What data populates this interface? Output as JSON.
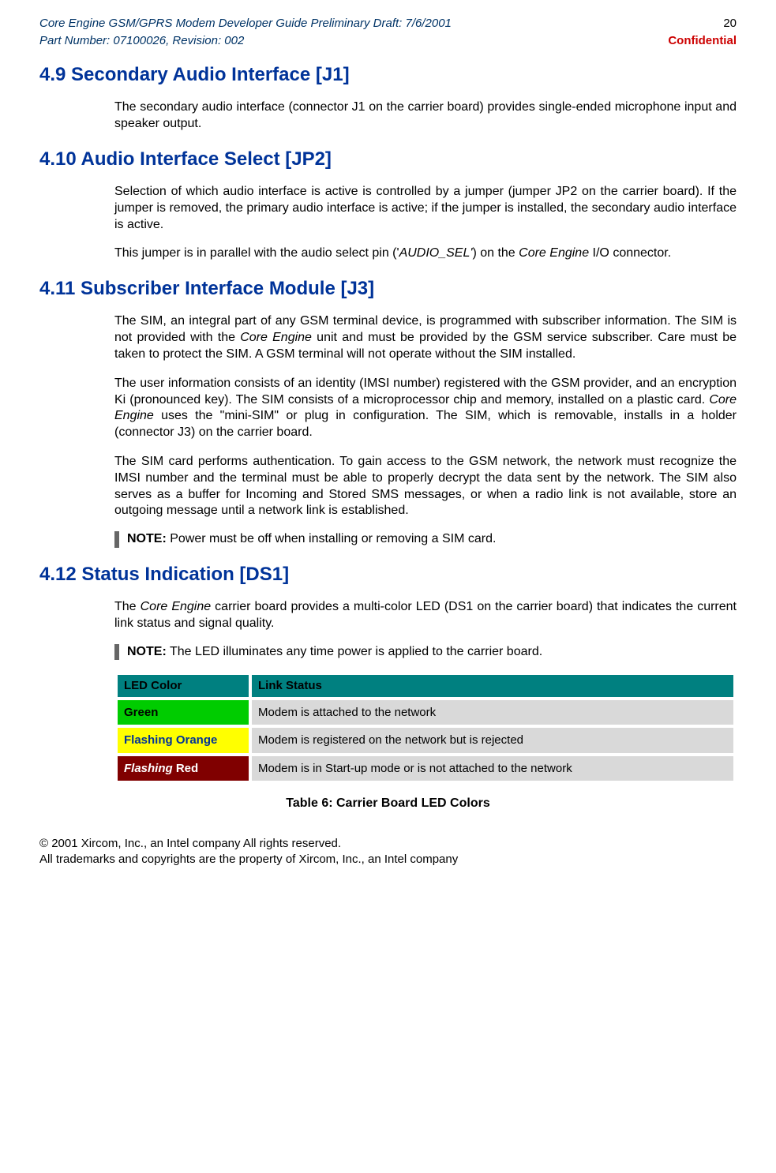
{
  "header": {
    "left_line1": "Core Engine GSM/GPRS Modem Developer Guide Preliminary Draft: 7/6/2001",
    "right_line1": "20",
    "left_line2": "Part Number: 07100026, Revision: 002",
    "right_line2": "Confidential"
  },
  "sections": {
    "s49": {
      "title": "4.9 Secondary Audio Interface [J1]",
      "p1": "The secondary audio interface (connector J1 on the carrier board) provides single-ended microphone input and speaker output."
    },
    "s410": {
      "title": "4.10 Audio Interface Select [JP2]",
      "p1": "Selection of which audio interface is active is controlled by a jumper (jumper JP2 on the carrier board).  If the jumper is removed, the primary audio interface is active; if the jumper is installed, the secondary audio interface is active.",
      "p2_a": "This jumper is in parallel with the audio select pin ('",
      "p2_i": "AUDIO_SEL'",
      "p2_b": ") on the ",
      "p2_ce": "Core Engine",
      "p2_c": " I/O connector."
    },
    "s411": {
      "title": "4.11 Subscriber Interface Module [J3]",
      "p1_a": "The SIM, an integral part of any GSM terminal device, is programmed with subscriber information. The SIM is not provided with the ",
      "p1_ce": "Core Engine",
      "p1_b": " unit and must be provided by the GSM service subscriber. Care must be taken to protect the SIM. A GSM terminal will not operate without the SIM installed.",
      "p2_a": "The user information consists of an identity (IMSI number) registered with the GSM provider, and an encryption Ki (pronounced key). The SIM consists of a microprocessor chip and memory, installed on a plastic card. ",
      "p2_ce": "Core Engine",
      "p2_b": " uses the \"mini-SIM\" or plug in configuration. The SIM, which is removable, installs in a holder (connector J3) on the carrier board.",
      "p3": "The SIM card performs authentication. To gain access to the GSM network, the network must recognize the IMSI number and the terminal must be able to properly decrypt the data sent by the network. The SIM also serves as a buffer for Incoming and Stored SMS messages, or when a radio link is not available, store an outgoing message until a network link is established.",
      "note_label": "NOTE:",
      "note_text": " Power must be off when installing or removing a SIM card."
    },
    "s412": {
      "title": "4.12 Status Indication [DS1]",
      "p1_a": "The ",
      "p1_ce": "Core Engine",
      "p1_b": " carrier board provides a multi-color LED (DS1 on the carrier board) that indicates the current link status and signal quality.",
      "note_label": "NOTE:",
      "note_text": " The LED illuminates any time power is applied to the carrier board."
    }
  },
  "table": {
    "header_col1": "LED Color",
    "header_col2": "Link Status",
    "rows": [
      {
        "color_label": "Green",
        "desc": "Modem is attached to the network"
      },
      {
        "color_label": "Flashing Orange",
        "desc": "Modem is registered on the network but is rejected"
      },
      {
        "color_label_a": "Flashing",
        "color_label_b": " Red",
        "desc": "Modem is in Start-up mode or is not attached to the network"
      }
    ],
    "caption": "Table 6: Carrier Board LED Colors"
  },
  "footer": {
    "line1": "© 2001 Xircom, Inc., an Intel company All rights reserved.",
    "line2": "All trademarks and copyrights are the property of Xircom, Inc., an Intel company"
  }
}
